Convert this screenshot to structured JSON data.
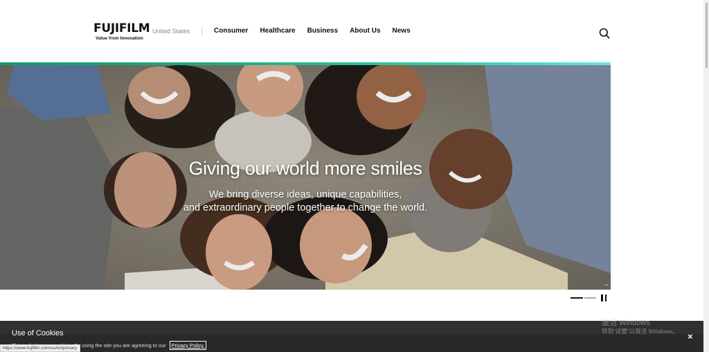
{
  "header": {
    "logo_text": "FUJIFILM",
    "logo_tagline": "Value from Innovation",
    "region": "United States",
    "nav": [
      {
        "label": "Consumer"
      },
      {
        "label": "Healthcare"
      },
      {
        "label": "Business"
      },
      {
        "label": "About Us"
      },
      {
        "label": "News"
      }
    ],
    "search_icon": "search-icon"
  },
  "hero": {
    "title": "Giving our world more smiles",
    "subtitle_line1": "We bring diverse ideas, unique capabilities,",
    "subtitle_line2": "and extraordinary people together to change the world.",
    "accent_color": "#12b488",
    "slides_total": 2,
    "active_slide": 1
  },
  "cookie": {
    "title": "Use of Cookies",
    "text": "This website uses cookies. By using the site you are agreeing to our",
    "link": "Privacy Policy.",
    "close": "×"
  },
  "watermark": {
    "line1": "激活 Windows",
    "line2": "转到“设置”以激活 Windows。"
  },
  "status_url": "https://www.fujifilm.com/us/en/privacy"
}
